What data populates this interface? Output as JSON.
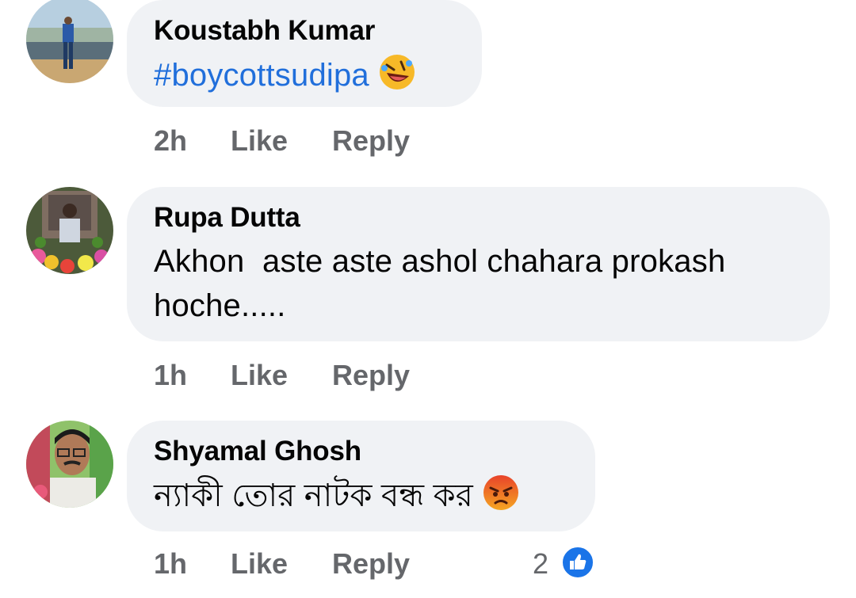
{
  "comments": [
    {
      "author": "Koustabh Kumar",
      "text": "#boycottsudipa",
      "emoji": "rolling-on-floor-laughing-emoji",
      "time": "2h",
      "like_label": "Like",
      "reply_label": "Reply"
    },
    {
      "author": "Rupa Dutta",
      "text_line1": "Akhon  aste aste ashol chahara prokash",
      "text_line2": "hoche.....",
      "time": "1h",
      "like_label": "Like",
      "reply_label": "Reply"
    },
    {
      "author": "Shyamal Ghosh",
      "text": "ন্যাকী তোর নাটক বন্ধ কর",
      "emoji": "angry-face-emoji",
      "time": "1h",
      "like_label": "Like",
      "reply_label": "Reply",
      "reaction_count": "2",
      "reaction_icon": "like-thumbs-up-icon"
    }
  ],
  "colors": {
    "bubble": "#f0f2f5",
    "author": "#050505",
    "meta": "#65676b",
    "hashtag": "#216fdb",
    "like_blue": "#1a74e8"
  }
}
